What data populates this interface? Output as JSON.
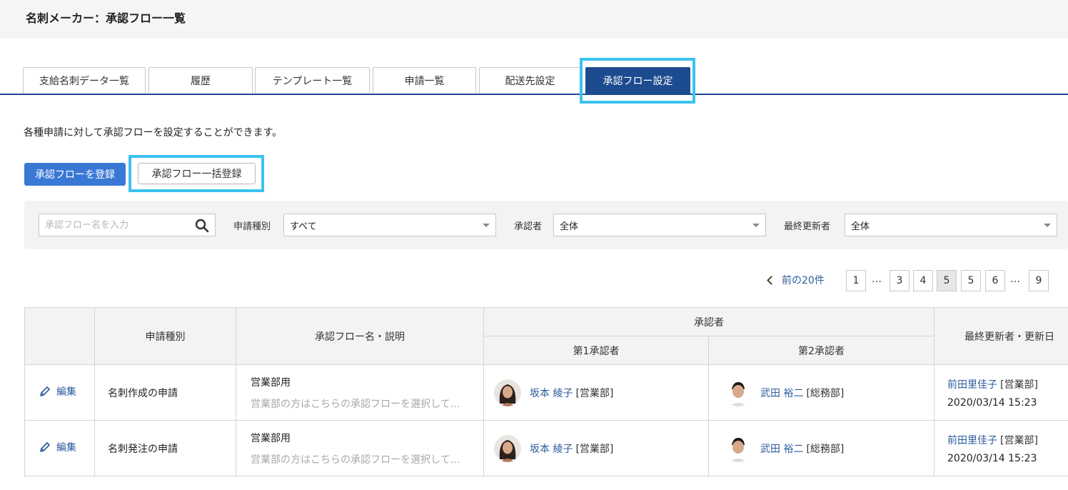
{
  "header": {
    "title": "名刺メーカー：承認フロー一覧"
  },
  "tabs": [
    {
      "label": "支給名刺データ一覧",
      "active": false
    },
    {
      "label": "履歴",
      "active": false
    },
    {
      "label": "テンプレート一覧",
      "active": false
    },
    {
      "label": "申請一覧",
      "active": false
    },
    {
      "label": "配送先設定",
      "active": false
    },
    {
      "label": "承認フロー設定",
      "active": true
    }
  ],
  "description": "各種申請に対して承認フローを設定することができます。",
  "actions": {
    "register_label": "承認フローを登録",
    "bulk_register_label": "承認フロー一括登録"
  },
  "filters": {
    "search_placeholder": "承認フロー名を入力",
    "type_label": "申請種別",
    "type_value": "すべて",
    "approver_label": "承認者",
    "approver_value": "全体",
    "updater_label": "最終更新者",
    "updater_value": "全体"
  },
  "pagination": {
    "prev_label": "前の20件",
    "pages": [
      "1",
      "…",
      "3",
      "4",
      "5",
      "5",
      "6",
      "…",
      "9"
    ],
    "current_index": 4
  },
  "table": {
    "headers": {
      "type": "申請種別",
      "flow": "承認フロー名・説明",
      "approvers": "承認者",
      "approver1": "第1承認者",
      "approver2": "第2承認者",
      "updater": "最終更新者・更新日"
    },
    "rows": [
      {
        "edit_label": "編集",
        "type": "名刺作成の申請",
        "flow_name": "営業部用",
        "flow_desc": "営業部の方はこちらの承認フローを選択して…",
        "approver1_name": "坂本 綾子",
        "approver1_dept": "[営業部]",
        "approver2_name": "武田 裕二",
        "approver2_dept": "[総務部]",
        "updater_name": "前田里佳子",
        "updater_dept": "[営業部]",
        "updated_at": "2020/03/14 15:23"
      },
      {
        "edit_label": "編集",
        "type": "名刺発注の申請",
        "flow_name": "営業部用",
        "flow_desc": "営業部の方はこちらの承認フローを選択して…",
        "approver1_name": "坂本 綾子",
        "approver1_dept": "[営業部]",
        "approver2_name": "武田 裕二",
        "approver2_dept": "[総務部]",
        "updater_name": "前田里佳子",
        "updater_dept": "[営業部]",
        "updated_at": "2020/03/14 15:23"
      }
    ]
  },
  "colors": {
    "primary": "#3a78d6",
    "tab_active": "#1d4b8f",
    "link": "#2c5b9c",
    "highlight": "#3cc2ef"
  },
  "icons": {
    "search": "search-icon",
    "edit": "pencil-icon",
    "prev": "chevron-left-icon",
    "select_caret": "caret-down-icon"
  }
}
